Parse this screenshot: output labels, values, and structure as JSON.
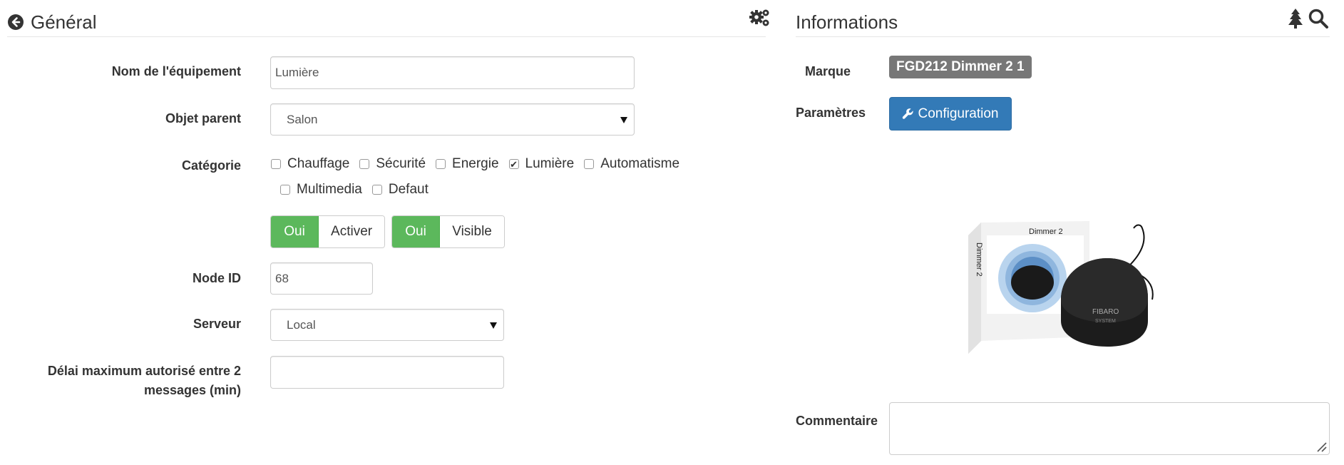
{
  "general": {
    "title": "Général",
    "fields": {
      "name_label": "Nom de l'équipement",
      "name_value": "Lumière",
      "parent_label": "Objet parent",
      "parent_value": "Salon",
      "category_label": "Catégorie",
      "categories": [
        {
          "label": "Chauffage",
          "checked": false
        },
        {
          "label": "Sécurité",
          "checked": false
        },
        {
          "label": "Energie",
          "checked": false
        },
        {
          "label": "Lumière",
          "checked": true
        },
        {
          "label": "Automatisme",
          "checked": false
        },
        {
          "label": "Multimedia",
          "checked": false
        },
        {
          "label": "Defaut",
          "checked": false
        }
      ],
      "activate_on": "Oui",
      "activate_label": "Activer",
      "visible_on": "Oui",
      "visible_label": "Visible",
      "node_label": "Node ID",
      "node_value": "68",
      "server_label": "Serveur",
      "server_value": "Local",
      "delay_label_line1": "Délai maximum autorisé entre 2",
      "delay_label_line2": "messages (min)",
      "delay_value": ""
    }
  },
  "info": {
    "title": "Informations",
    "brand_label": "Marque",
    "brand_value": "FGD212 Dimmer 2 1",
    "params_label": "Paramètres",
    "config_button": "Configuration",
    "product_box_text": "Dimmer 2",
    "product_box_side": "Dimmer 2",
    "product_brand": "FIBARO",
    "product_brand_sub": "SYSTEM",
    "comment_label": "Commentaire",
    "comment_value": ""
  },
  "colors": {
    "success": "#5cb85c",
    "primary": "#337ab7",
    "badge": "#777777"
  }
}
